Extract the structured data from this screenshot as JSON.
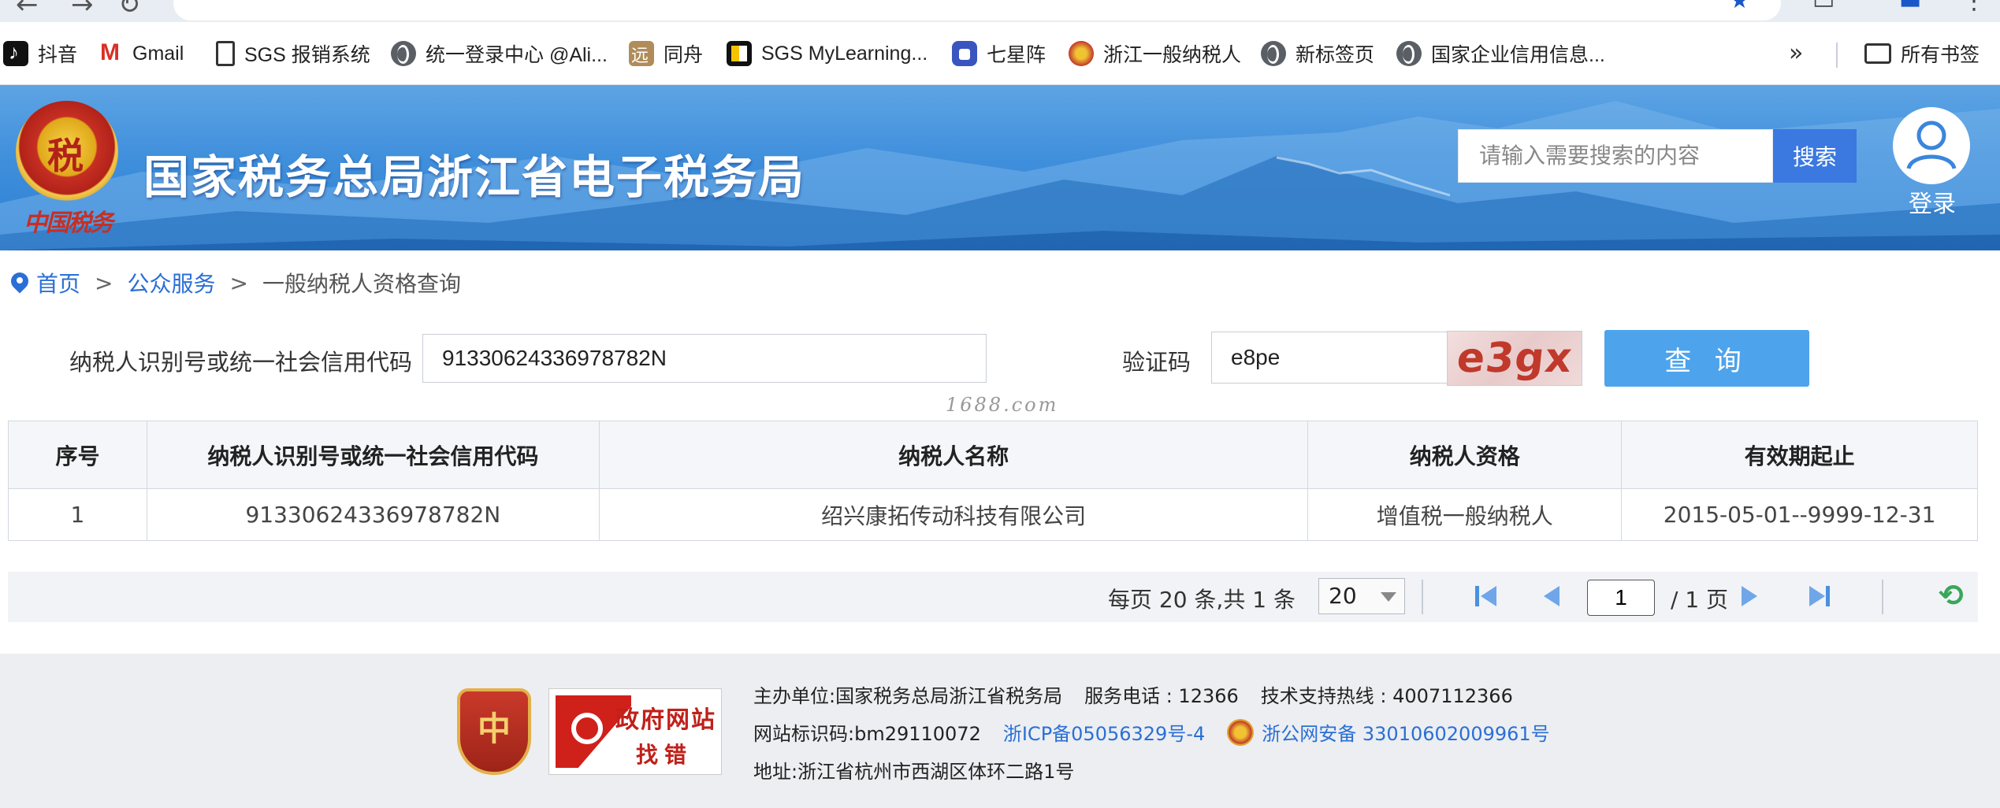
{
  "browser": {
    "bookmarks": [
      {
        "label": "抖音",
        "icon": "tiktok-icon"
      },
      {
        "label": "Gmail",
        "icon": "gmail-icon"
      },
      {
        "label": "SGS 报销系统",
        "icon": "document-icon"
      },
      {
        "label": "统一登录中心 @Ali...",
        "icon": "globe-icon"
      },
      {
        "label": "同舟",
        "icon": "tongzhou-icon"
      },
      {
        "label": "SGS MyLearning...",
        "icon": "mylearning-icon"
      },
      {
        "label": "七星阵",
        "icon": "lock-icon"
      },
      {
        "label": "浙江一般纳税人",
        "icon": "emblem-icon"
      },
      {
        "label": "新标签页",
        "icon": "globe-icon"
      },
      {
        "label": "国家企业信用信息...",
        "icon": "globe-icon"
      }
    ],
    "more_bookmarks": "»",
    "all_bookmarks": "所有书签"
  },
  "banner": {
    "emblem_subtitle": "中国税务",
    "site_title": "国家税务总局浙江省电子税务局",
    "search_placeholder": "请输入需要搜索的内容",
    "search_button": "搜索",
    "login_label": "登录"
  },
  "breadcrumb": {
    "home": "首页",
    "separator": ">",
    "section": "公众服务",
    "current": "一般纳税人资格查询"
  },
  "query": {
    "taxpayer_id_label": "纳税人识别号或统一社会信用代码",
    "taxpayer_id_value": "91330624336978782N",
    "captcha_label": "验证码",
    "captcha_input_value": "e8pe",
    "captcha_image_text": "e3gx",
    "submit_button": "查 询"
  },
  "watermark": "1688.com",
  "results": {
    "headers": [
      "序号",
      "纳税人识别号或统一社会信用代码",
      "纳税人名称",
      "纳税人资格",
      "有效期起止"
    ],
    "rows": [
      [
        "1",
        "91330624336978782N",
        "绍兴康拓传动科技有限公司",
        "增值税一般纳税人",
        "2015-05-01--9999-12-31"
      ]
    ]
  },
  "pagination": {
    "summary": "每页 20 条,共 1 条",
    "page_size": "20",
    "current_page": "1",
    "total_pages": "/ 1 页"
  },
  "footer": {
    "gov_badge_line1": "政府网站",
    "gov_badge_line2": "找错",
    "host_label": "主办单位:",
    "host_value": "国家税务总局浙江省税务局",
    "phone": "服务电话 : 12366",
    "support": "技术支持热线 : 4007112366",
    "site_id": "网站标识码:bm29110072",
    "icp": "浙ICP备05056329号-4",
    "police": "浙公网安备 33010602009961号",
    "address_label": "地址:",
    "address_value": "浙江省杭州市西湖区体环二路1号"
  },
  "colors": {
    "banner_blue": "#3f8fdc",
    "link_blue": "#2a6fd6",
    "query_button": "#4da3ec",
    "search_button": "#3b78e0"
  }
}
